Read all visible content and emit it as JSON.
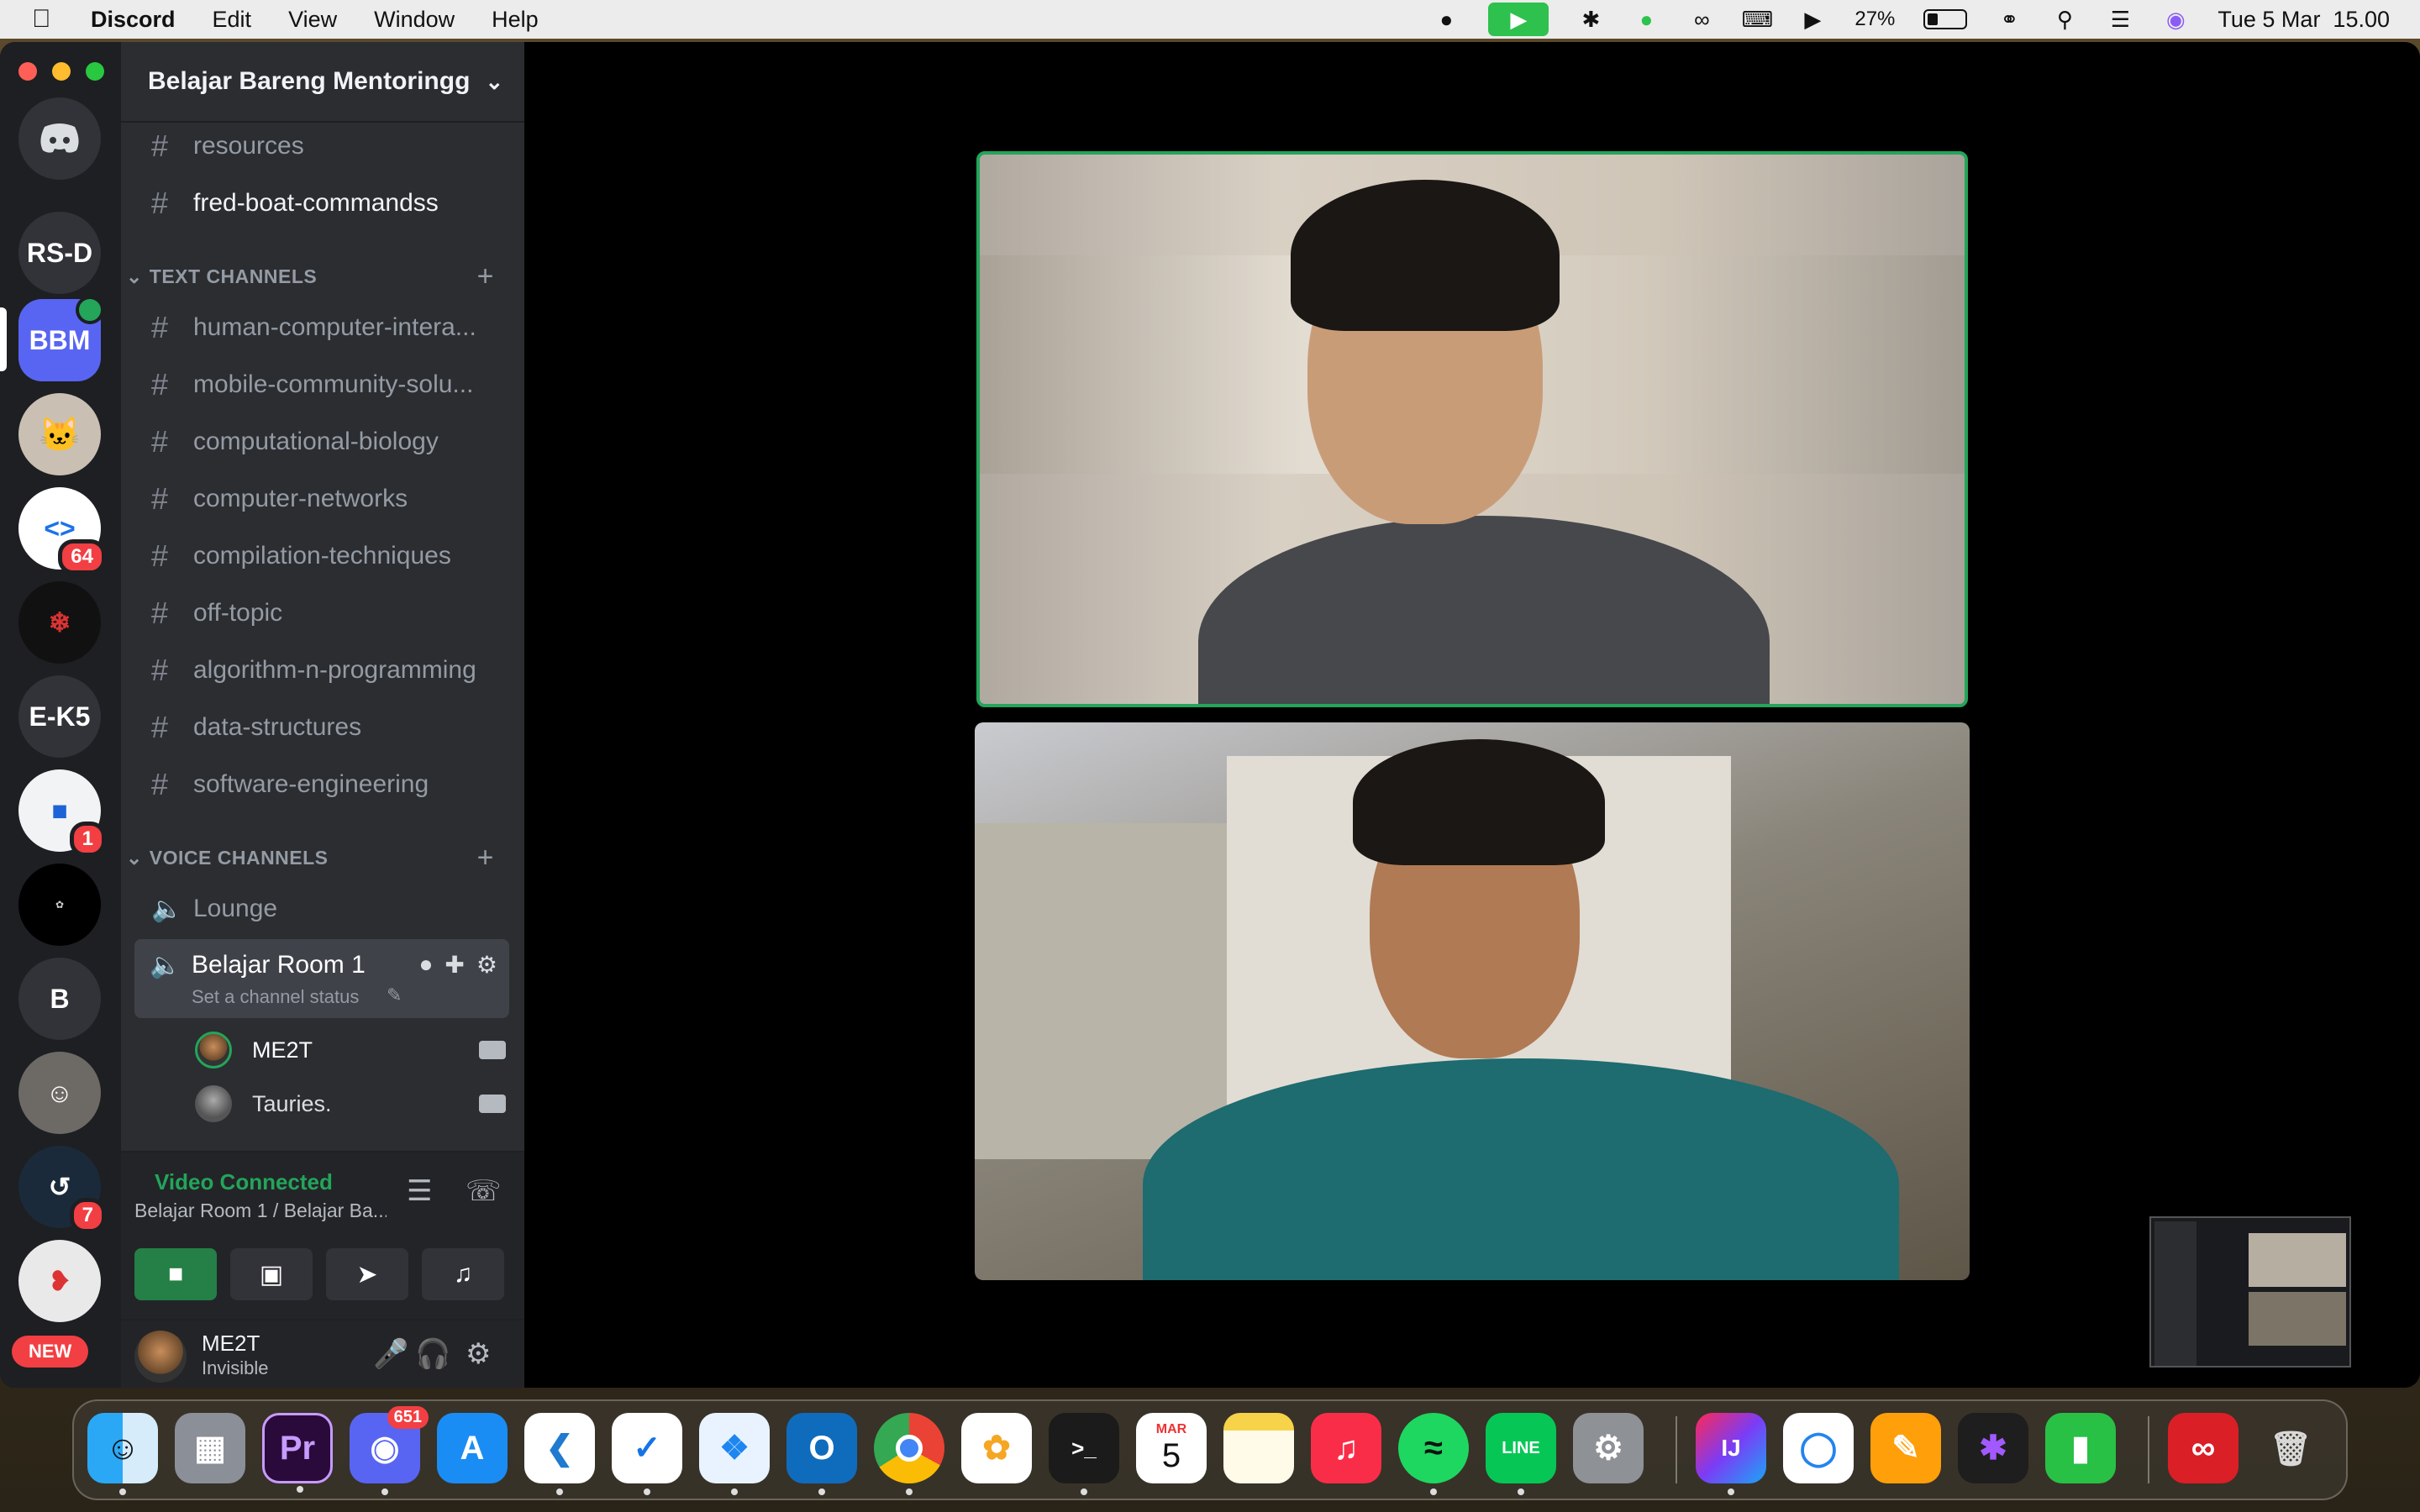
{
  "menubar": {
    "app": "Discord",
    "items": [
      "Edit",
      "View",
      "Window",
      "Help"
    ],
    "battery": "27%",
    "datetime": "Tue 5 Mar  15.00"
  },
  "servers": {
    "items": [
      {
        "label": "RS-D"
      },
      {
        "label": "BBM",
        "selected": true
      },
      {
        "label": "64"
      },
      {
        "label": "E-K5"
      },
      {
        "label": "1"
      },
      {
        "label": "B"
      },
      {
        "label": "7"
      }
    ],
    "new_label": "NEW"
  },
  "guild": {
    "name": "Belajar Bareng Mentoringg"
  },
  "channels": {
    "top": [
      "resources",
      "fred-boat-commandss"
    ],
    "text_header": "TEXT CHANNELS",
    "text": [
      "human-computer-intera...",
      "mobile-community-solu...",
      "computational-biology",
      "computer-networks",
      "compilation-techniques",
      "off-topic",
      "algorithm-n-programming",
      "data-structures",
      "software-engineering"
    ],
    "voice_header": "VOICE CHANNELS",
    "voice": [
      "Lounge"
    ],
    "active_voice": {
      "name": "Belajar Room 1",
      "status": "Set a channel status",
      "users": [
        "ME2T",
        "Tauries."
      ]
    }
  },
  "rtc": {
    "connected": "Video Connected",
    "location": "Belajar Room 1 / Belajar Ba..."
  },
  "user": {
    "name": "ME2T",
    "status": "Invisible"
  },
  "dock": {
    "discord_badge": "651",
    "calendar_month": "MAR",
    "calendar_day": "5"
  },
  "colors": {
    "discord_blurple": "#5865f2",
    "connected_green": "#23a55a",
    "badge_red": "#f23f43"
  }
}
